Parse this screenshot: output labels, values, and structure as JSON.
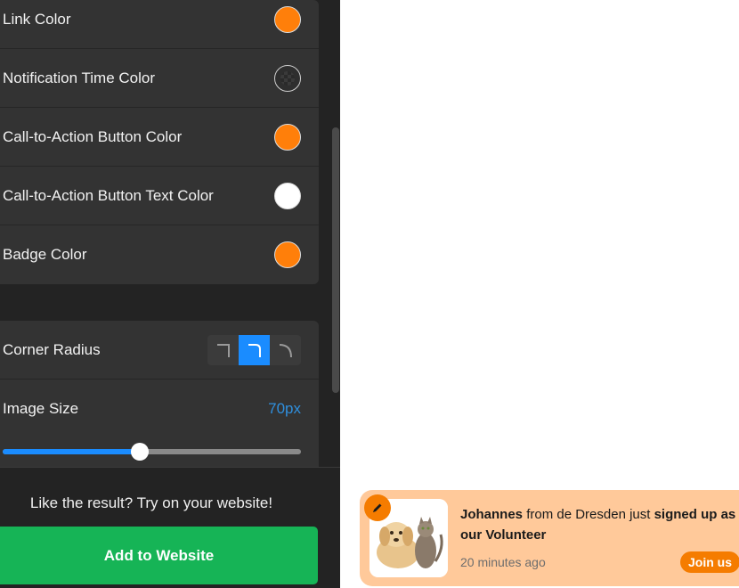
{
  "color_settings": [
    {
      "label": "Link Color",
      "color": "#ff7f0a",
      "icon": "color-swatch"
    },
    {
      "label": "Notification Time Color",
      "color": "transparent",
      "icon": "color-swatch-transparent"
    },
    {
      "label": "Call-to-Action Button Color",
      "color": "#ff7f0a",
      "icon": "color-swatch"
    },
    {
      "label": "Call-to-Action Button Text Color",
      "color": "#ffffff",
      "icon": "color-swatch"
    },
    {
      "label": "Badge Color",
      "color": "#ff7f0a",
      "icon": "color-swatch"
    }
  ],
  "layout_settings": {
    "corner_radius": {
      "label": "Corner Radius",
      "options": [
        "corner-square-icon",
        "corner-rounded-icon",
        "corner-curved-icon"
      ],
      "selected": 1
    },
    "image_size": {
      "label": "Image Size",
      "value_text": "70px",
      "slider_fraction": 0.46
    }
  },
  "footer": {
    "prompt": "Like the result? Try on your website!",
    "button_label": "Add to Website"
  },
  "notification": {
    "name": "Johannes",
    "middle": " from de Dresden just ",
    "action": "signed up as our Volunteer",
    "time": "20 minutes ago",
    "cta": "Join us",
    "image_icon": "dog-and-cat-photo",
    "badge_icon": "pencil-icon",
    "background": "#ffc99a",
    "accent": "#f57c00"
  },
  "colors": {
    "panel": "#232323",
    "card": "#333333",
    "accent_blue": "#1a8cff",
    "button_green": "#16b456"
  }
}
